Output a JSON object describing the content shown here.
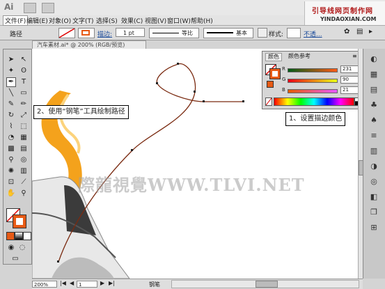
{
  "app": {
    "logo": "Ai"
  },
  "menu": [
    "文件(F)",
    "编辑(E)",
    "对象(O)",
    "文字(T)",
    "选择(S)",
    "效果(C)",
    "视图(V)",
    "窗口(W)",
    "帮助(H)"
  ],
  "site_watermark": {
    "cn": "引导线网页制作网",
    "en": "YINDAOXIAN.COM"
  },
  "control_bar": {
    "object_type": "路径",
    "stroke_label": "描边:",
    "stroke_weight": "1 pt",
    "profile": "等比",
    "brush": "基本",
    "style_label": "样式:",
    "opacity_label": "不透..."
  },
  "document_tab": "汽车素材.ai* @ 200% (RGB/预览)",
  "color_panel": {
    "tabs": [
      "颜色",
      "颜色参考"
    ],
    "channels": [
      {
        "label": "R",
        "value": "231"
      },
      {
        "label": "G",
        "value": "90"
      },
      {
        "label": "B",
        "value": "21"
      }
    ],
    "stroke_color": "#e75a15"
  },
  "callouts": {
    "left": "2、使用“钢笔”工具绘制路径",
    "right": "1、设置描边颜色"
  },
  "canvas_watermark": "際龍視覺WWW.TLVI.NET",
  "status": {
    "zoom": "200%",
    "page": "1",
    "tool": "钢笔"
  },
  "colors": {
    "path": "#7a2a10",
    "swirl": "#f4a21c",
    "accent": "#e75a15"
  }
}
